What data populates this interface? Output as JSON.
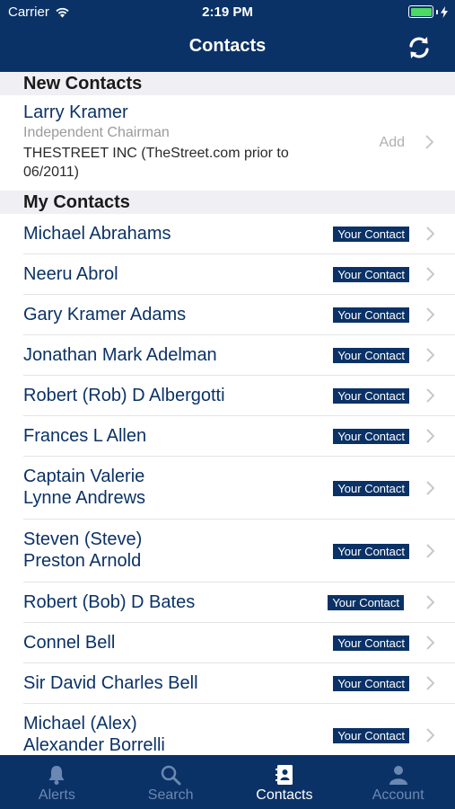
{
  "status": {
    "carrier": "Carrier",
    "time": "2:19 PM"
  },
  "nav": {
    "title": "Contacts"
  },
  "new_contacts": {
    "header": "New Contacts",
    "name": "Larry Kramer",
    "role": "Independent Chairman",
    "company": "THESTREET INC (TheStreet.com prior to 06/2011)",
    "action": "Add"
  },
  "my_contacts": {
    "header": "My Contacts",
    "badge": "Your Contact",
    "items": [
      "Michael Abrahams",
      "Neeru Abrol",
      "Gary Kramer Adams",
      "Jonathan Mark Adelman",
      "Robert (Rob) D Albergotti",
      "Frances L Allen",
      "Captain Valerie Lynne Andrews",
      "Steven (Steve) Preston Arnold",
      "Robert (Bob) D Bates",
      "Connel Bell",
      "Sir David Charles Bell",
      "Michael (Alex) Alexander Borrelli"
    ]
  },
  "tabs": [
    {
      "label": "Alerts",
      "icon": "bell-icon"
    },
    {
      "label": "Search",
      "icon": "search-icon"
    },
    {
      "label": "Contacts",
      "icon": "contacts-book-icon",
      "active": true
    },
    {
      "label": "Account",
      "icon": "person-icon"
    }
  ],
  "colors": {
    "brand": "#0b3266",
    "inactive_tab": "#6b88b2",
    "battery": "#4cd964"
  }
}
